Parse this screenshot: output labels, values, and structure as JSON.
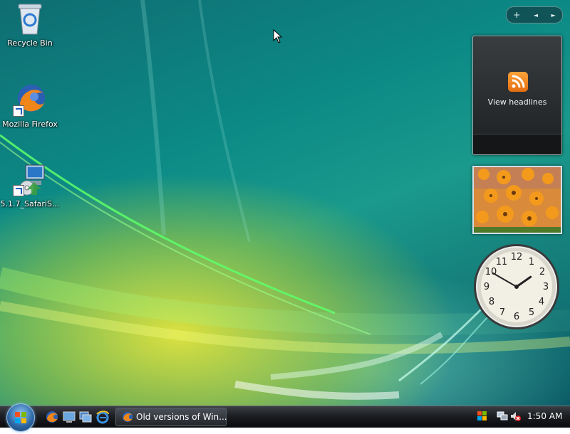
{
  "desktop": {
    "icons": [
      {
        "label": "Recycle Bin",
        "icon": "recycle-bin-icon"
      },
      {
        "label": "Mozilla Firefox",
        "icon": "firefox-icon"
      },
      {
        "label": "5.1.7_SafariS...",
        "icon": "installer-icon"
      }
    ]
  },
  "sidebar": {
    "controls": {
      "add": "+",
      "prev": "◄",
      "next": "►"
    },
    "feed_gadget": {
      "label": "View headlines"
    },
    "clock": {
      "hour": 1,
      "minute": 50
    }
  },
  "taskbar": {
    "task_items": [
      {
        "label": "Old versions of Win...",
        "icon": "firefox-icon"
      }
    ],
    "time": "1:50 AM"
  },
  "colors": {
    "accent": "#2f6aa8",
    "rss": "#f08a24"
  }
}
